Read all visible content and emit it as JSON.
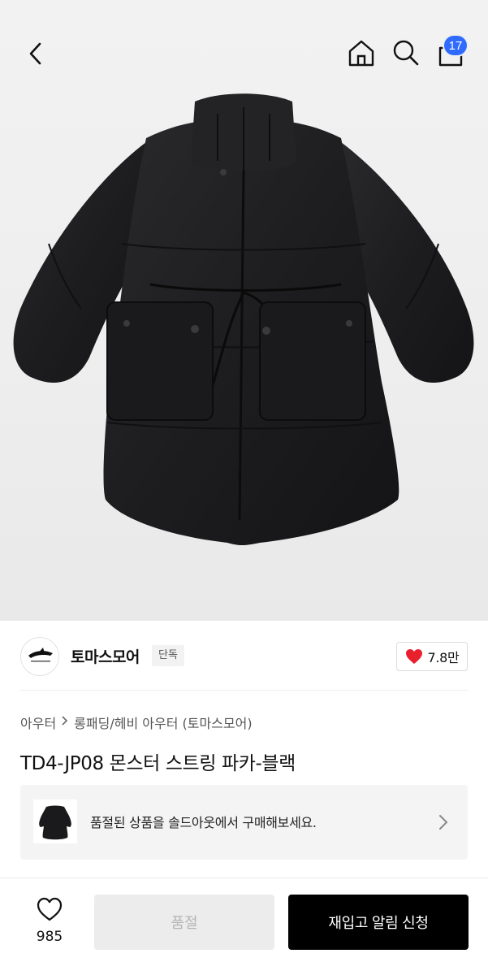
{
  "header": {
    "back_icon": "chevron-left-icon",
    "home_icon": "home-icon",
    "search_icon": "search-icon",
    "cart_icon": "shopping-bag-icon",
    "cart_count": "17",
    "badge_color": "#2f6bff"
  },
  "brand": {
    "name": "토마스모어",
    "badge": "단독",
    "like_count": "7.8만",
    "heart_color": "#e8202e"
  },
  "breadcrumb": {
    "level1": "아우터",
    "level2": "롱패딩/헤비 아우터 (토마스모어)"
  },
  "product": {
    "title": "TD4-JP08 몬스터 스트링 파카-블랙"
  },
  "soldout_banner": {
    "text": "품절된 상품을 솔드아웃에서 구매해보세요."
  },
  "bottom_bar": {
    "wish_count": "985",
    "soldout_label": "품절",
    "restock_label": "재입고 알림 신청"
  }
}
